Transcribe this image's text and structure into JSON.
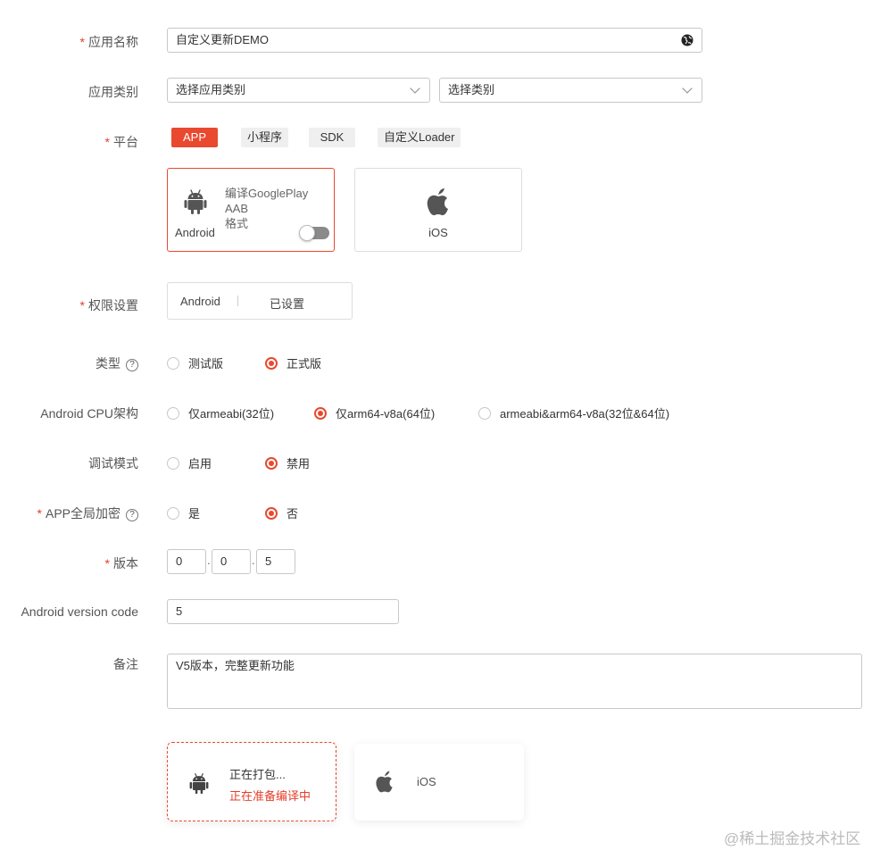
{
  "form": {
    "app_name": {
      "label": "应用名称",
      "value": "自定义更新DEMO",
      "icon": "globe-icon"
    },
    "category": {
      "label": "应用类别",
      "select1": "选择应用类别",
      "select2": "选择类别"
    },
    "platform": {
      "label": "平台",
      "tags": [
        "APP",
        "小程序",
        "SDK",
        "自定义Loader"
      ],
      "active_tag": "APP",
      "android_card": {
        "name": "Android",
        "desc_line1": "编译GooglePlay AAB",
        "desc_line2": "格式",
        "aab_toggle": false
      },
      "ios_card": {
        "name": "iOS"
      }
    },
    "permission": {
      "label": "权限设置",
      "platform": "Android",
      "status": "已设置"
    },
    "type": {
      "label": "类型",
      "help": "?",
      "options": [
        "测试版",
        "正式版"
      ],
      "selected": "正式版"
    },
    "cpu": {
      "label": "Android CPU架构",
      "options": [
        "仅armeabi(32位)",
        "仅arm64-v8a(64位)",
        "armeabi&arm64-v8a(32位&64位)"
      ],
      "selected": "仅arm64-v8a(64位)"
    },
    "debug": {
      "label": "调试模式",
      "options": [
        "启用",
        "禁用"
      ],
      "selected": "禁用"
    },
    "encrypt": {
      "label": "APP全局加密",
      "help": "?",
      "options": [
        "是",
        "否"
      ],
      "selected": "否"
    },
    "version": {
      "label": "版本",
      "parts": [
        "0",
        "0",
        "5"
      ],
      "sep": "."
    },
    "version_code": {
      "label": "Android version code",
      "value": "5"
    },
    "remark": {
      "label": "备注",
      "value": "V5版本，完整更新功能"
    }
  },
  "build": {
    "android": {
      "status": "正在打包...",
      "detail": "正在准备编译中"
    },
    "ios": {
      "name": "iOS"
    }
  },
  "watermark": "@稀土掘金技术社区",
  "colors": {
    "accent": "#e8492f",
    "required": "#e53e2b"
  }
}
